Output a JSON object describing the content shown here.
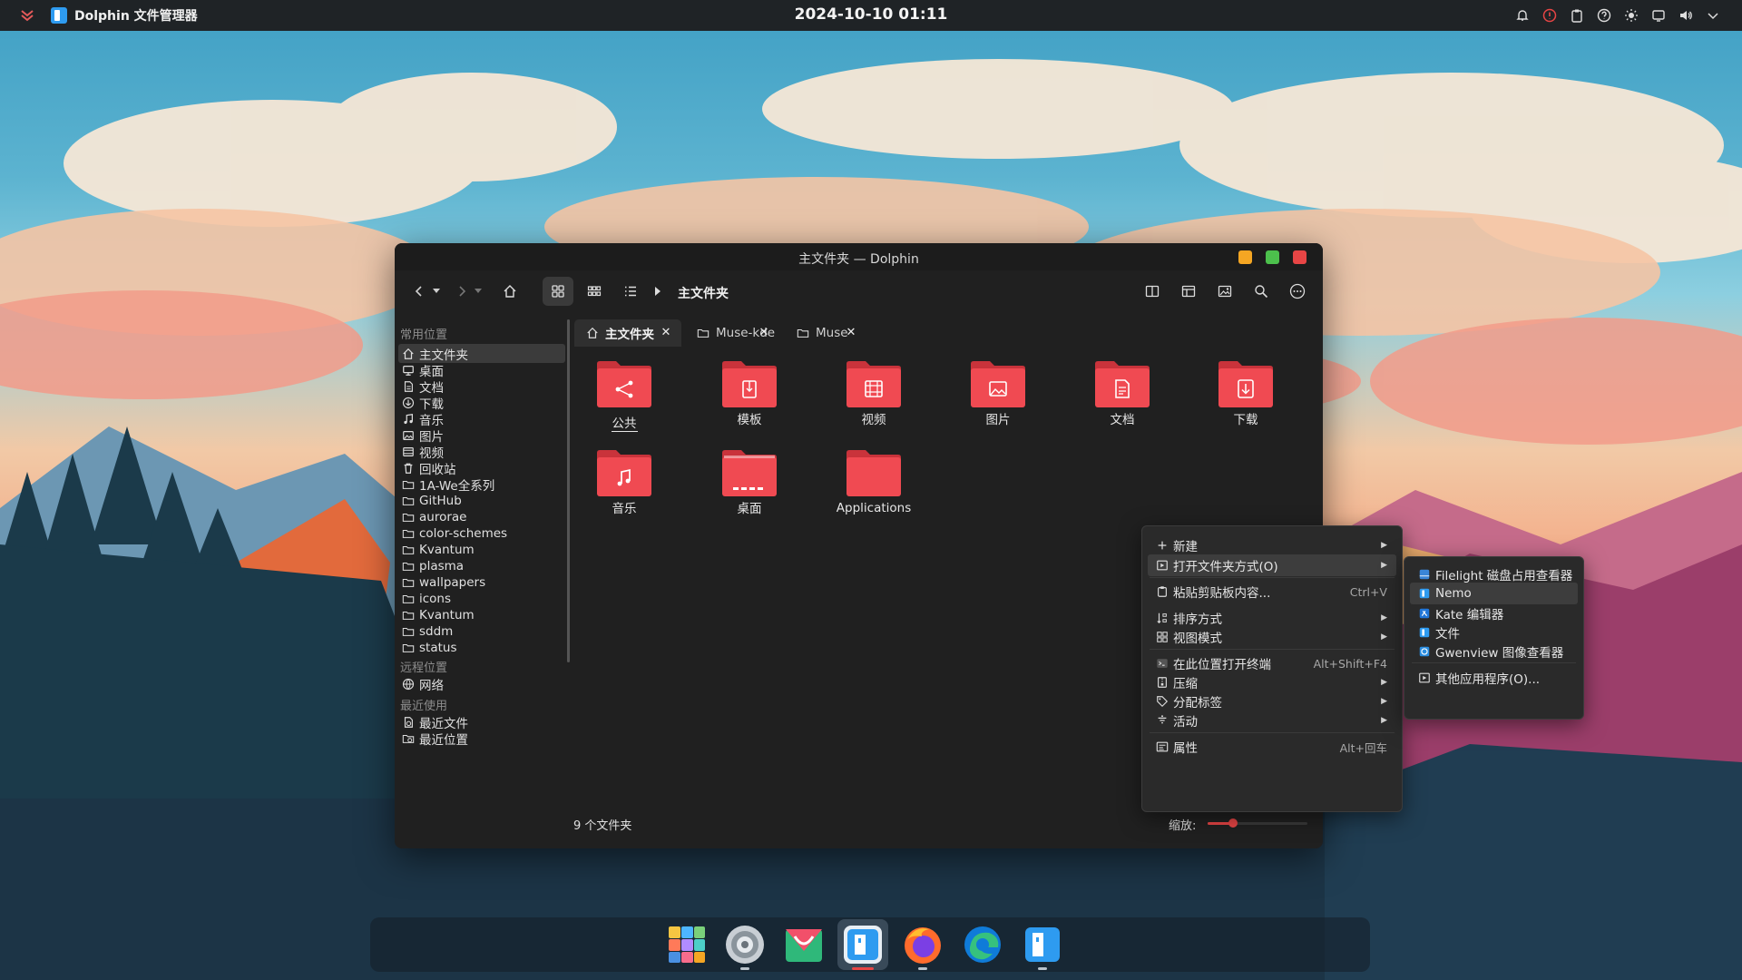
{
  "topbar": {
    "app_name": "Dolphin 文件管理器",
    "clock": "2024-10-10 01:11",
    "tray_icons": [
      "bell-icon",
      "alert-icon",
      "clipboard-icon",
      "help-icon",
      "brightness-icon",
      "display-icon",
      "volume-icon",
      "chevron-down-icon"
    ]
  },
  "window": {
    "title": "主文件夹 — Dolphin",
    "breadcrumb": "主文件夹"
  },
  "sidebar": {
    "section_places": "常用位置",
    "places": [
      {
        "label": "主文件夹",
        "icon": "home-icon"
      },
      {
        "label": "桌面",
        "icon": "desktop-icon"
      },
      {
        "label": "文档",
        "icon": "documents-icon"
      },
      {
        "label": "下载",
        "icon": "download-icon"
      },
      {
        "label": "音乐",
        "icon": "music-icon"
      },
      {
        "label": "图片",
        "icon": "pictures-icon"
      },
      {
        "label": "视频",
        "icon": "video-icon"
      },
      {
        "label": "回收站",
        "icon": "trash-icon"
      },
      {
        "label": "1A-We全系列",
        "icon": "folder-icon"
      },
      {
        "label": "GitHub",
        "icon": "folder-icon"
      },
      {
        "label": "aurorae",
        "icon": "folder-icon"
      },
      {
        "label": "color-schemes",
        "icon": "folder-icon"
      },
      {
        "label": "Kvantum",
        "icon": "folder-icon"
      },
      {
        "label": "plasma",
        "icon": "folder-icon"
      },
      {
        "label": "wallpapers",
        "icon": "folder-icon"
      },
      {
        "label": "icons",
        "icon": "folder-icon"
      },
      {
        "label": "Kvantum",
        "icon": "folder-icon"
      },
      {
        "label": "sddm",
        "icon": "folder-icon"
      },
      {
        "label": "status",
        "icon": "folder-icon"
      }
    ],
    "section_remote": "远程位置",
    "remote": [
      {
        "label": "网络",
        "icon": "network-icon"
      }
    ],
    "section_recent": "最近使用",
    "recent": [
      {
        "label": "最近文件",
        "icon": "recent-files-icon"
      },
      {
        "label": "最近位置",
        "icon": "recent-locations-icon"
      }
    ]
  },
  "tabs": [
    {
      "label": "主文件夹",
      "icon": "home-icon",
      "active": true
    },
    {
      "label": "Muse-kde",
      "icon": "folder-icon",
      "active": false
    },
    {
      "label": "Muse",
      "icon": "folder-icon",
      "active": false
    }
  ],
  "folders": [
    {
      "label": "公共",
      "emblem": "share"
    },
    {
      "label": "模板",
      "emblem": "template"
    },
    {
      "label": "视频",
      "emblem": "video"
    },
    {
      "label": "图片",
      "emblem": "image"
    },
    {
      "label": "文档",
      "emblem": "document"
    },
    {
      "label": "下载",
      "emblem": "download"
    },
    {
      "label": "音乐",
      "emblem": "music"
    },
    {
      "label": "桌面",
      "emblem": "desktop"
    },
    {
      "label": "Applications",
      "emblem": "none"
    }
  ],
  "status": {
    "count": "9 个文件夹",
    "zoom_label": "缩放:",
    "zoom_level": 0.25
  },
  "context_menu": [
    {
      "label": "新建",
      "icon": "plus-icon",
      "shortcut": "",
      "submenu": true,
      "highlight": false
    },
    {
      "label": "打开文件夹方式(O)",
      "icon": "open-with-icon",
      "shortcut": "",
      "submenu": true,
      "highlight": true
    },
    {
      "label": "粘贴剪贴板内容...",
      "icon": "paste-icon",
      "shortcut": "Ctrl+V",
      "submenu": false,
      "highlight": false
    },
    {
      "label": "排序方式",
      "icon": "sort-icon",
      "shortcut": "",
      "submenu": true,
      "highlight": false
    },
    {
      "label": "视图模式",
      "icon": "view-mode-icon",
      "shortcut": "",
      "submenu": true,
      "highlight": false
    },
    {
      "label": "在此位置打开终端",
      "icon": "terminal-icon",
      "shortcut": "Alt+Shift+F4",
      "submenu": false,
      "highlight": false
    },
    {
      "label": "压缩",
      "icon": "compress-icon",
      "shortcut": "",
      "submenu": true,
      "highlight": false
    },
    {
      "label": "分配标签",
      "icon": "tag-icon",
      "shortcut": "",
      "submenu": true,
      "highlight": false
    },
    {
      "label": "活动",
      "icon": "activities-icon",
      "shortcut": "",
      "submenu": true,
      "highlight": false
    },
    {
      "label": "属性",
      "icon": "properties-icon",
      "shortcut": "Alt+回车",
      "submenu": false,
      "highlight": false
    }
  ],
  "open_with_menu": [
    {
      "label": "Filelight 磁盘占用查看器",
      "icon": "filelight-icon",
      "highlight": false
    },
    {
      "label": "Nemo",
      "icon": "nemo-icon",
      "highlight": true
    },
    {
      "label": "Kate 编辑器",
      "icon": "kate-icon",
      "highlight": false
    },
    {
      "label": "文件",
      "icon": "files-icon",
      "highlight": false
    },
    {
      "label": "Gwenview 图像查看器",
      "icon": "gwenview-icon",
      "highlight": false
    },
    {
      "label": "其他应用程序(O)...",
      "icon": "other-apps-icon",
      "highlight": false
    }
  ],
  "dock": [
    {
      "name": "app-launcher-icon",
      "running": false
    },
    {
      "name": "system-settings-icon",
      "running": true
    },
    {
      "name": "software-store-icon",
      "running": false
    },
    {
      "name": "dolphin-icon",
      "running": true
    },
    {
      "name": "firefox-icon",
      "running": true
    },
    {
      "name": "edge-icon",
      "running": false
    },
    {
      "name": "finder-icon",
      "running": true
    }
  ],
  "colors": {
    "accent": "#e84545",
    "folder": "#f04a52",
    "panel": "#1f2326",
    "window": "#202020"
  }
}
